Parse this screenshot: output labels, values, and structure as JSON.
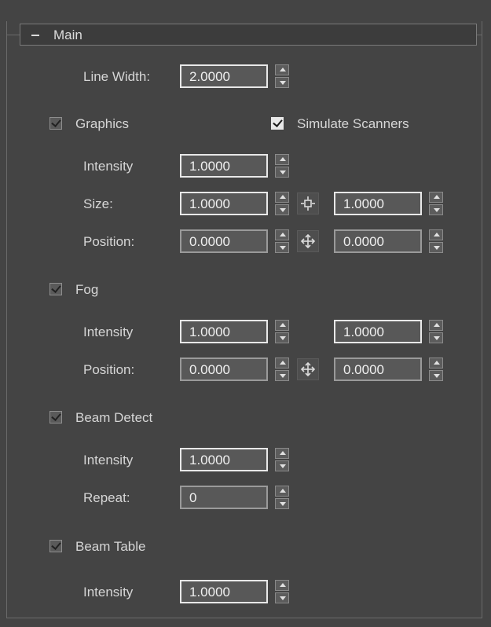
{
  "rollout": {
    "title": "Main"
  },
  "line_width": {
    "label": "Line Width:",
    "value": "2.0000"
  },
  "graphics": {
    "label": "Graphics",
    "checked": true,
    "simulate_label": "Simulate Scanners",
    "intensity_label": "Intensity",
    "intensity": "1.0000",
    "size_label": "Size:",
    "size_x": "1.0000",
    "size_y": "1.0000",
    "position_label": "Position:",
    "pos_x": "0.0000",
    "pos_y": "0.0000"
  },
  "fog": {
    "label": "Fog",
    "checked": true,
    "intensity_label": "Intensity",
    "intensity_a": "1.0000",
    "intensity_b": "1.0000",
    "position_label": "Position:",
    "pos_x": "0.0000",
    "pos_y": "0.0000"
  },
  "beam_detect": {
    "label": "Beam Detect",
    "checked": true,
    "intensity_label": "Intensity",
    "intensity": "1.0000",
    "repeat_label": "Repeat:",
    "repeat": "0"
  },
  "beam_table": {
    "label": "Beam Table",
    "checked": true,
    "intensity_label": "Intensity",
    "intensity": "1.0000"
  },
  "icons": {
    "lock": "move-lock-icon",
    "collapse": "minus-icon"
  }
}
